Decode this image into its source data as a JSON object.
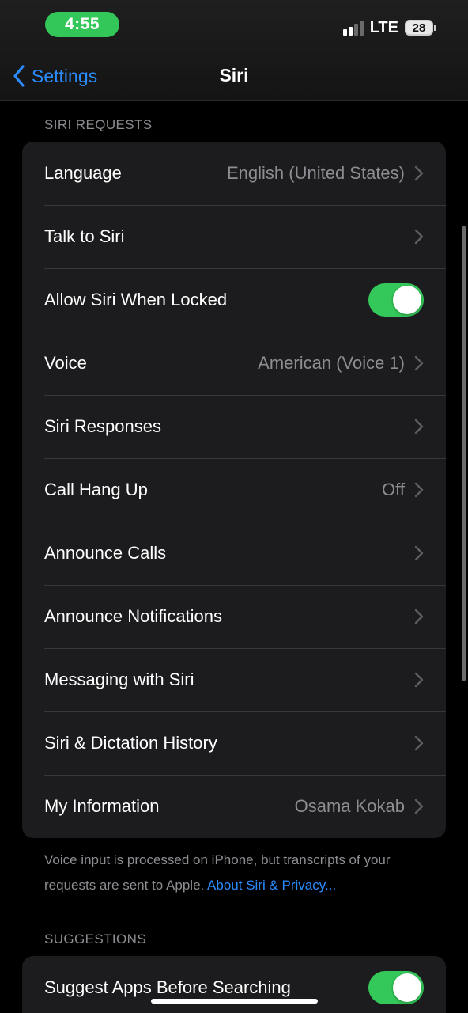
{
  "status_bar": {
    "time": "4:55",
    "network": "LTE",
    "battery": "28",
    "accent_color": "#34c759"
  },
  "nav": {
    "back_label": "Settings",
    "title": "Siri",
    "back_icon": "chevron-left-icon",
    "link_color": "#2b8cff"
  },
  "siri_requests": {
    "header": "SIRI REQUESTS",
    "rows": [
      {
        "label": "Language",
        "value": "English (United States)"
      },
      {
        "label": "Talk to Siri",
        "value": ""
      },
      {
        "label": "Allow Siri When Locked",
        "toggle": "on"
      },
      {
        "label": "Voice",
        "value": "American (Voice 1)"
      },
      {
        "label": "Siri Responses",
        "value": ""
      },
      {
        "label": "Call Hang Up",
        "value": "Off"
      },
      {
        "label": "Announce Calls",
        "value": ""
      },
      {
        "label": "Announce Notifications",
        "value": ""
      },
      {
        "label": "Messaging with Siri",
        "value": ""
      },
      {
        "label": "Siri & Dictation History",
        "value": ""
      },
      {
        "label": "My Information",
        "value": "Osama Kokab"
      }
    ],
    "footer_text": "Voice input is processed on iPhone, but transcripts of your requests are sent to Apple.",
    "footer_link": "About Siri & Privacy..."
  },
  "suggestions": {
    "header": "SUGGESTIONS",
    "rows": [
      {
        "label": "Suggest Apps Before Searching",
        "toggle": "on"
      }
    ]
  }
}
